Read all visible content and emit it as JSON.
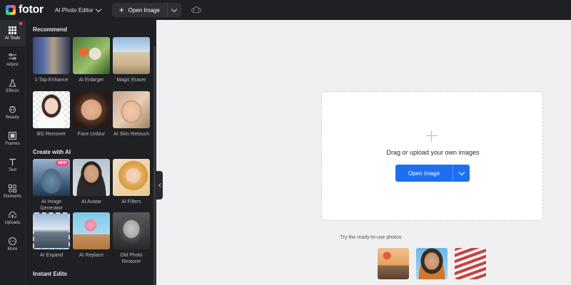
{
  "app": {
    "logo_text": "fotor",
    "editor_menu": "AI Photo Editor",
    "open_image": "Open Image"
  },
  "rail": [
    {
      "label": "AI Tools",
      "icon": "grid-icon"
    },
    {
      "label": "Adjust",
      "icon": "sliders-icon"
    },
    {
      "label": "Effects",
      "icon": "flask-icon"
    },
    {
      "label": "Beauty",
      "icon": "face-icon"
    },
    {
      "label": "Frames",
      "icon": "frame-icon"
    },
    {
      "label": "Text",
      "icon": "text-icon"
    },
    {
      "label": "Elements",
      "icon": "shapes-icon"
    },
    {
      "label": "Uploads",
      "icon": "cloud-upload-icon"
    },
    {
      "label": "More",
      "icon": "more-icon"
    }
  ],
  "panel": {
    "recommend_title": "Recommend",
    "recommend": [
      {
        "label": "1-Tap Enhance"
      },
      {
        "label": "AI Enlarger"
      },
      {
        "label": "Magic Eraser"
      },
      {
        "label": "BG Remover"
      },
      {
        "label": "Face Unblur"
      },
      {
        "label": "AI Skin Retouch"
      }
    ],
    "create_title": "Create with AI",
    "create": [
      {
        "label": "AI Image Generator",
        "badge": "NEW"
      },
      {
        "label": "AI Avatar"
      },
      {
        "label": "AI Filters"
      },
      {
        "label": "AI Expand"
      },
      {
        "label": "AI Replace"
      },
      {
        "label": "Old Photo Restorer"
      }
    ],
    "instant_title": "Instant Edits"
  },
  "canvas": {
    "drop_text": "Drag or upload your own images",
    "open_button": "Open Image",
    "try_text": "Try the ready-to-use photos"
  }
}
